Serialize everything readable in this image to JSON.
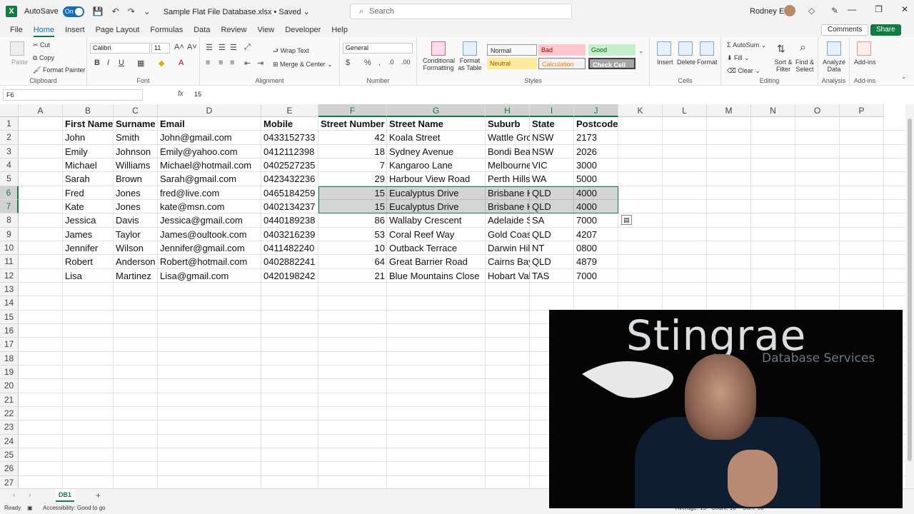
{
  "titlebar": {
    "autosave_label": "AutoSave",
    "autosave_state": "On",
    "doc_title": "Sample Flat File Database.xlsx • Saved ⌄",
    "search_placeholder": "Search",
    "user_name": "Rodney Ellis"
  },
  "menu": {
    "tabs": [
      "File",
      "Home",
      "Insert",
      "Page Layout",
      "Formulas",
      "Data",
      "Review",
      "View",
      "Developer",
      "Help"
    ],
    "active": "Home",
    "comments_label": "Comments",
    "share_label": "Share"
  },
  "ribbon": {
    "clipboard": {
      "label": "Clipboard",
      "paste": "Paste",
      "cut": "Cut",
      "copy": "Copy",
      "format_painter": "Format Painter"
    },
    "font": {
      "label": "Font",
      "family": "Calibri",
      "size": "11"
    },
    "alignment": {
      "label": "Alignment",
      "wrap_text": "Wrap Text",
      "merge_center": "Merge & Center"
    },
    "number": {
      "label": "Number",
      "format": "General"
    },
    "styles": {
      "label": "Styles",
      "conditional": "Conditional Formatting",
      "format_as_table": "Format as Table",
      "cells": [
        {
          "name": "Normal",
          "bg": "#ffffff",
          "fg": "#000000"
        },
        {
          "name": "Bad",
          "bg": "#ffc7ce",
          "fg": "#9c0006"
        },
        {
          "name": "Good",
          "bg": "#c6efce",
          "fg": "#006100"
        },
        {
          "name": "Neutral",
          "bg": "#ffeb9c",
          "fg": "#9c5700"
        },
        {
          "name": "Calculation",
          "bg": "#f2f2f2",
          "fg": "#fa7d00"
        },
        {
          "name": "Check Cell",
          "bg": "#a5a5a5",
          "fg": "#ffffff"
        }
      ]
    },
    "cells": {
      "label": "Cells",
      "insert": "Insert",
      "delete": "Delete",
      "format": "Format"
    },
    "editing": {
      "label": "Editing",
      "autosum": "AutoSum",
      "fill": "Fill",
      "clear": "Clear",
      "sort_filter": "Sort & Filter",
      "find_select": "Find & Select"
    },
    "analysis": {
      "label": "Analysis",
      "analyze_data": "Analyze Data"
    },
    "addins": {
      "label": "Add-ins",
      "addins": "Add-ins"
    }
  },
  "formula_bar": {
    "name_box": "F6",
    "fx": "fx",
    "value": "15"
  },
  "sheet": {
    "columns": [
      "A",
      "B",
      "C",
      "D",
      "E",
      "F",
      "G",
      "H",
      "I",
      "J",
      "K",
      "L",
      "M",
      "N",
      "O",
      "P"
    ],
    "selected_columns": [
      "F",
      "G",
      "H",
      "I",
      "J"
    ],
    "row_numbers": [
      "1",
      "2",
      "3",
      "4",
      "5",
      "6",
      "7",
      "8",
      "9",
      "10",
      "11",
      "12",
      "13",
      "14",
      "15",
      "16",
      "17",
      "18",
      "19",
      "20",
      "21",
      "22",
      "23",
      "24",
      "25",
      "26",
      "27"
    ],
    "selected_rows": [
      "6",
      "7"
    ],
    "headers": [
      "First Name",
      "Surname",
      "Email",
      "Mobile",
      "Street Number",
      "Street Name",
      "Suburb",
      "State",
      "Postcode"
    ],
    "rows": [
      [
        "John",
        "Smith",
        "John@gmail.com",
        "0433152733",
        "42",
        "Koala Street",
        "Wattle Grove",
        "NSW",
        "2173"
      ],
      [
        "Emily",
        "Johnson",
        "Emily@yahoo.com",
        "0412112398",
        "18",
        "Sydney Avenue",
        "Bondi Beach",
        "NSW",
        "2026"
      ],
      [
        "Michael",
        "Williams",
        "Michael@hotmail.com",
        "0402527235",
        "7",
        "Kangaroo Lane",
        "Melbourne",
        "VIC",
        "3000"
      ],
      [
        "Sarah",
        "Brown",
        "Sarah@gmail.com",
        "0423432236",
        "29",
        "Harbour View Road",
        "Perth Hills",
        "WA",
        "5000"
      ],
      [
        "Fred",
        "Jones",
        "fred@live.com",
        "0465184259",
        "15",
        "Eucalyptus Drive",
        "Brisbane Heights",
        "QLD",
        "4000"
      ],
      [
        "Kate",
        "Jones",
        "kate@msn.com",
        "0402134237",
        "15",
        "Eucalyptus Drive",
        "Brisbane Heights",
        "QLD",
        "4000"
      ],
      [
        "Jessica",
        "Davis",
        "Jessica@gmail.com",
        "0440189238",
        "86",
        "Wallaby Crescent",
        "Adelaide Shores",
        "SA",
        "7000"
      ],
      [
        "James",
        "Taylor",
        "James@oultook.com",
        "0403216239",
        "53",
        "Coral Reef Way",
        "Gold Coast",
        "QLD",
        "4207"
      ],
      [
        "Jennifer",
        "Wilson",
        "Jennifer@gmail.com",
        "0411482240",
        "10",
        "Outback Terrace",
        "Darwin Hills",
        "NT",
        "0800"
      ],
      [
        "Robert",
        "Anderson",
        "Robert@hotmail.com",
        "0402882241",
        "64",
        "Great Barrier Road",
        "Cairns Bay",
        "QLD",
        "4879"
      ],
      [
        "Lisa",
        "Martinez",
        "Lisa@gmail.com",
        "0420198242",
        "21",
        "Blue Mountains Close",
        "Hobart Valley",
        "TAS",
        "7000"
      ]
    ],
    "tab_name": "DB1"
  },
  "status": {
    "ready": "Ready",
    "accessibility": "Accessibility: Good to go",
    "average": "Average: 15",
    "count": "Count: 10",
    "sum": "Sum: 30"
  },
  "video": {
    "brand": "Stingrae",
    "tagline": "Database Services"
  },
  "colors": {
    "excel_green": "#107c41",
    "accent_blue": "#0f6cbd"
  }
}
